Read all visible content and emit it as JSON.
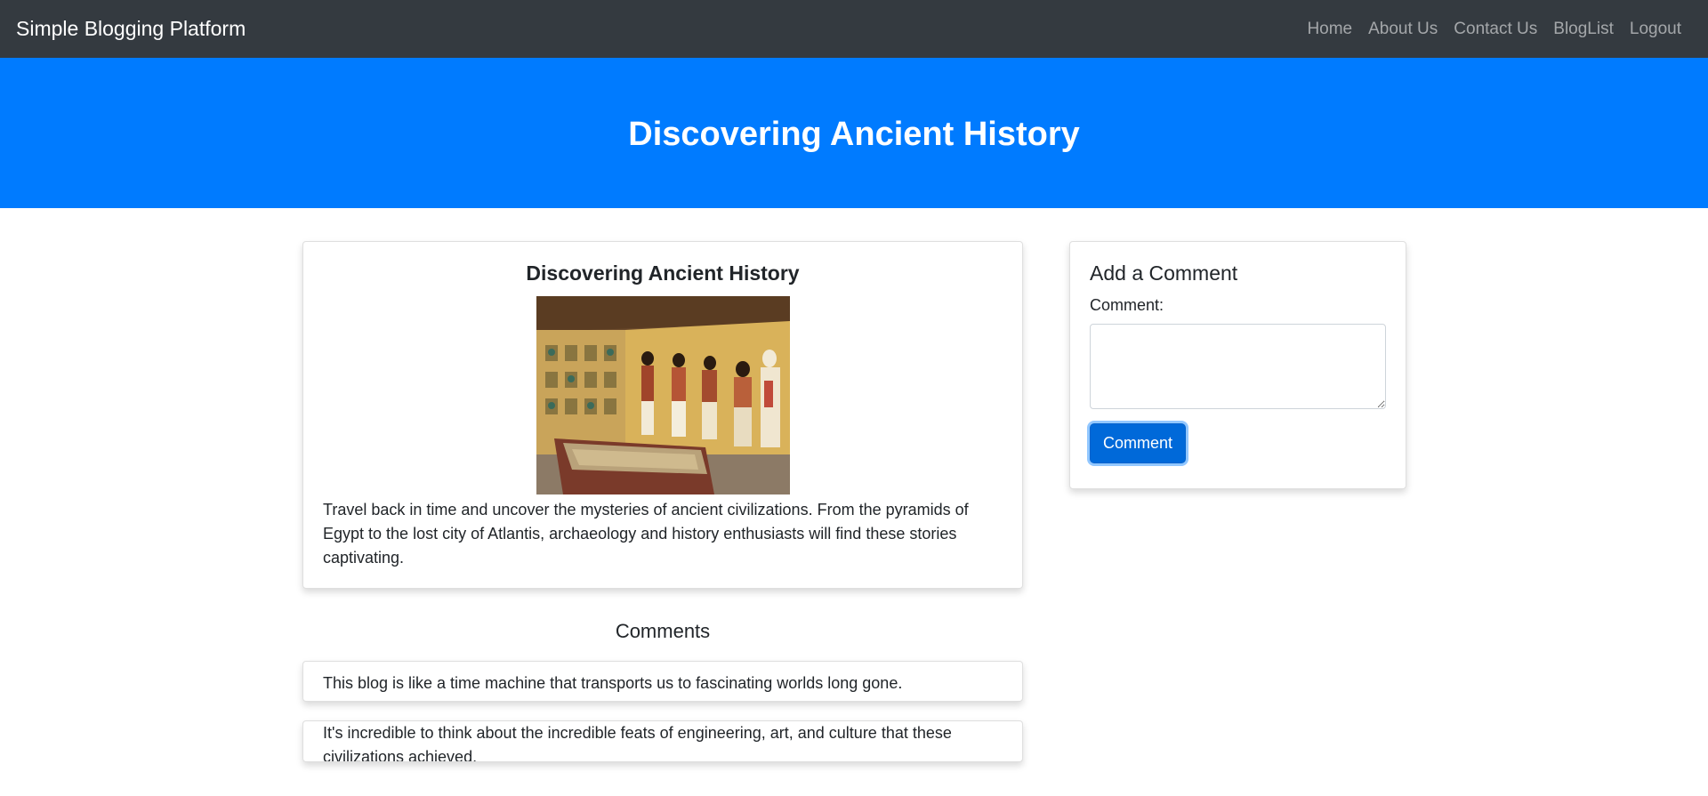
{
  "navbar": {
    "brand": "Simple Blogging Platform",
    "links": [
      "Home",
      "About Us",
      "Contact Us",
      "BlogList",
      "Logout"
    ]
  },
  "hero": {
    "title": "Discovering Ancient History"
  },
  "post": {
    "title": "Discovering Ancient History",
    "image_subject": "ancient-egyptian-tomb-painting",
    "body": "Travel back in time and uncover the mysteries of ancient civilizations. From the pyramids of Egypt to the lost city of Atlantis, archaeology and history enthusiasts will find these stories captivating."
  },
  "comment_form": {
    "heading": "Add a Comment",
    "label": "Comment:",
    "value": "",
    "button_label": "Comment"
  },
  "comments": {
    "title": "Comments",
    "items": [
      "This blog is like a time machine that transports us to fascinating worlds long gone.",
      "It's incredible to think about the incredible feats of engineering, art, and culture that these civilizations achieved."
    ]
  },
  "colors": {
    "navbar_bg": "#343a40",
    "hero_bg": "#007bff",
    "button_bg": "#0069d9"
  }
}
